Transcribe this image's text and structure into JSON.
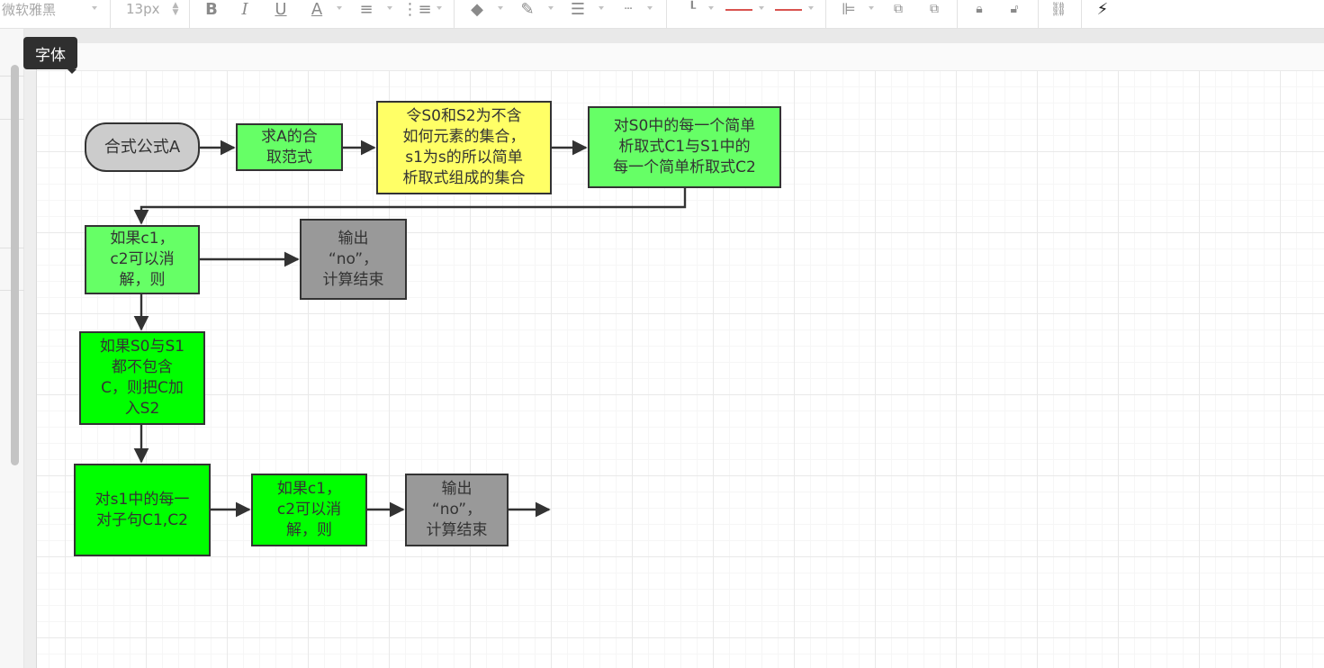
{
  "toolbar": {
    "font_name": "微软雅黑",
    "font_size": "13px",
    "icons": [
      "bold-icon",
      "italic-icon",
      "underline-icon",
      "font-color-icon",
      "align-icon",
      "line-spacing-icon",
      "fill-color-icon",
      "line-color-icon",
      "line-width-icon",
      "line-dash-icon",
      "connector-icon",
      "line-start-icon",
      "line-end-icon",
      "align-left-icon",
      "bring-front-icon",
      "send-back-icon",
      "lock-icon",
      "unlock-icon",
      "link-icon",
      "magic-wand-icon"
    ]
  },
  "tooltip": {
    "text": "字体"
  },
  "colors": {
    "green_light": "#66ff66",
    "green_bright": "#00ff00",
    "yellow": "#ffff66",
    "gray": "#999999",
    "terminal_gray": "#cccccc",
    "stroke": "#333333"
  },
  "diagram": {
    "nodes": [
      {
        "id": "n1",
        "text": "合式公式A",
        "shape": "terminator",
        "fill": "terminal_gray"
      },
      {
        "id": "n2",
        "text": "求A的合\n取范式",
        "shape": "rect",
        "fill": "green_light"
      },
      {
        "id": "n3",
        "text": "令S0和S2为不含\n如何元素的集合，\ns1为s的所以简单\n析取式组成的集合",
        "shape": "rect",
        "fill": "yellow"
      },
      {
        "id": "n4",
        "text": "对S0中的每一个简单\n析取式C1与S1中的\n每一个简单析取式C2",
        "shape": "rect",
        "fill": "green_light"
      },
      {
        "id": "n5",
        "text": "如果c1，\nc2可以消\n解，则",
        "shape": "rect",
        "fill": "green_light"
      },
      {
        "id": "n6",
        "text": "输出\n“no”，\n计算结束",
        "shape": "rect",
        "fill": "gray"
      },
      {
        "id": "n7",
        "text": "如果S0与S1\n都不包含\nC，则把C加\n入S2",
        "shape": "rect",
        "fill": "green_bright"
      },
      {
        "id": "n8",
        "text": "对s1中的每一\n对子句C1,C2",
        "shape": "rect",
        "fill": "green_bright"
      },
      {
        "id": "n9",
        "text": "如果c1，\nc2可以消\n解，则",
        "shape": "rect",
        "fill": "green_bright"
      },
      {
        "id": "n10",
        "text": "输出\n“no”，\n计算结束",
        "shape": "rect",
        "fill": "gray"
      }
    ],
    "edges": [
      {
        "from": "n1",
        "to": "n2"
      },
      {
        "from": "n2",
        "to": "n3"
      },
      {
        "from": "n3",
        "to": "n4"
      },
      {
        "from": "n4",
        "to": "n5"
      },
      {
        "from": "n5",
        "to": "n6"
      },
      {
        "from": "n5",
        "to": "n7"
      },
      {
        "from": "n7",
        "to": "n8"
      },
      {
        "from": "n8",
        "to": "n9"
      },
      {
        "from": "n9",
        "to": "n10"
      },
      {
        "from": "n10",
        "to": null
      }
    ]
  }
}
